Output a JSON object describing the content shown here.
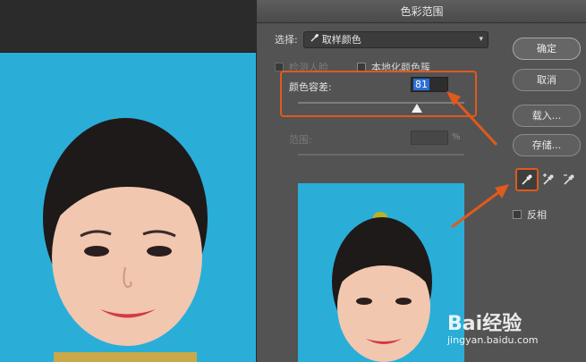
{
  "dialog": {
    "title": "色彩范围",
    "select_label": "选择:",
    "select_value": "取样颜色",
    "detect_faces_label": "检测人脸",
    "localized_clusters_label": "本地化颜色簇",
    "fuzziness_label": "颜色容差:",
    "fuzziness_value": "81",
    "fuzziness_level_fraction": 0.81,
    "range_label": "范围:",
    "range_unit": "%",
    "invert_label": "反相"
  },
  "buttons": {
    "ok": "确定",
    "cancel": "取消",
    "load": "载入...",
    "save": "存储..."
  },
  "tools": [
    "eyedropper-icon",
    "eyedropper-plus-icon",
    "eyedropper-minus-icon"
  ],
  "colors": {
    "accent_annotation": "#e05a1c",
    "background_blue": "#2aaed8",
    "selected_text": "#2a6fd6"
  },
  "watermark": {
    "brand": "Bai经验",
    "url": "jingyan.baidu.com"
  }
}
